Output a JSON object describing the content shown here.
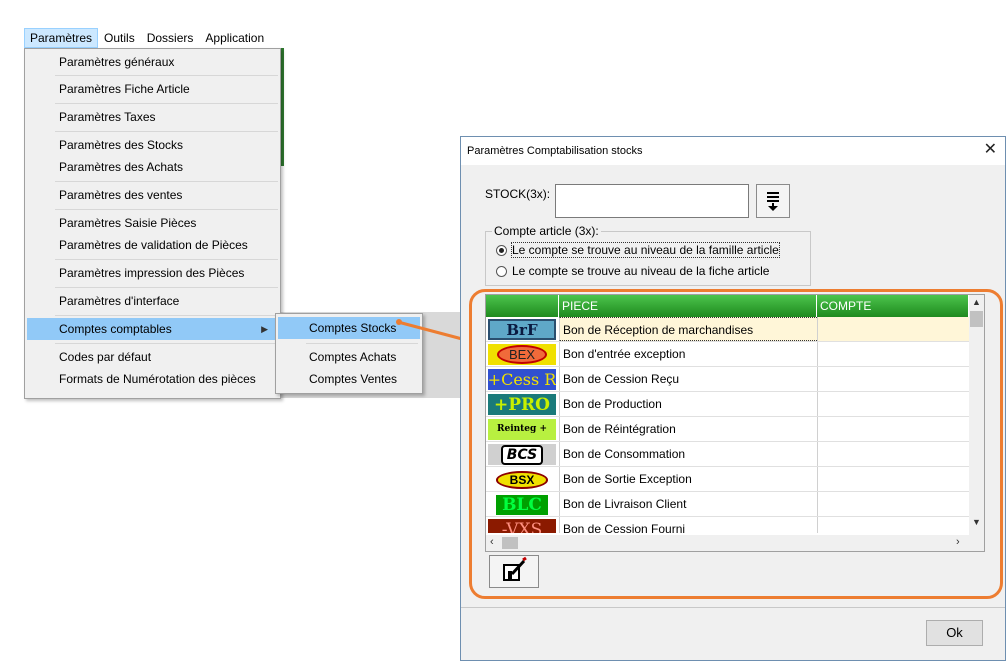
{
  "menubar": {
    "items": [
      "Paramètres",
      "Outils",
      "Dossiers",
      "Application"
    ]
  },
  "dropdown": {
    "items": [
      "Paramètres généraux",
      "Paramètres Fiche Article",
      "Paramètres Taxes",
      "Paramètres des Stocks",
      "Paramètres des Achats",
      "Paramètres des ventes",
      "Paramètres Saisie Pièces",
      "Paramètres de validation de Pièces",
      "Paramètres impression des Pièces",
      "Paramètres d'interface",
      "Comptes comptables",
      "Codes par défaut",
      "Formats de Numérotation des pièces"
    ]
  },
  "submenu": {
    "items": [
      "Comptes Stocks",
      "Comptes Achats",
      "Comptes Ventes"
    ]
  },
  "dialog": {
    "title": "Paramètres Comptabilisation stocks",
    "stock_label": "STOCK(3x):",
    "stock_value": "",
    "group_legend": "Compte article (3x):",
    "radio_famille": "Le compte se trouve au niveau de la famille article",
    "radio_fiche": "Le compte se trouve au niveau de la fiche article",
    "ok_label": "Ok",
    "grid": {
      "columns": [
        "",
        "PIECE",
        "COMPTE"
      ],
      "rows": [
        {
          "badge": "BrF",
          "piece": "Bon de Réception de marchandises",
          "compte": ""
        },
        {
          "badge": "BEX",
          "piece": "Bon d'entrée exception",
          "compte": ""
        },
        {
          "badge": "+Cess R",
          "piece": "Bon de Cession Reçu",
          "compte": ""
        },
        {
          "badge": "+PRO",
          "piece": "Bon de Production",
          "compte": ""
        },
        {
          "badge": "Reinteg +",
          "piece": "Bon de Réintégration",
          "compte": ""
        },
        {
          "badge": "BCS",
          "piece": "Bon de Consommation",
          "compte": ""
        },
        {
          "badge": "BSX",
          "piece": "Bon de Sortie Exception",
          "compte": ""
        },
        {
          "badge": "BLC",
          "piece": "Bon de Livraison Client",
          "compte": ""
        },
        {
          "badge": "-VXS",
          "piece": "Bon de Cession Fourni",
          "compte": ""
        }
      ]
    }
  },
  "colors": {
    "grid_header": "#2fa52f",
    "highlight": "#91c9f7",
    "annotation": "#ed7d31",
    "selected_row": "#fff6d8"
  }
}
